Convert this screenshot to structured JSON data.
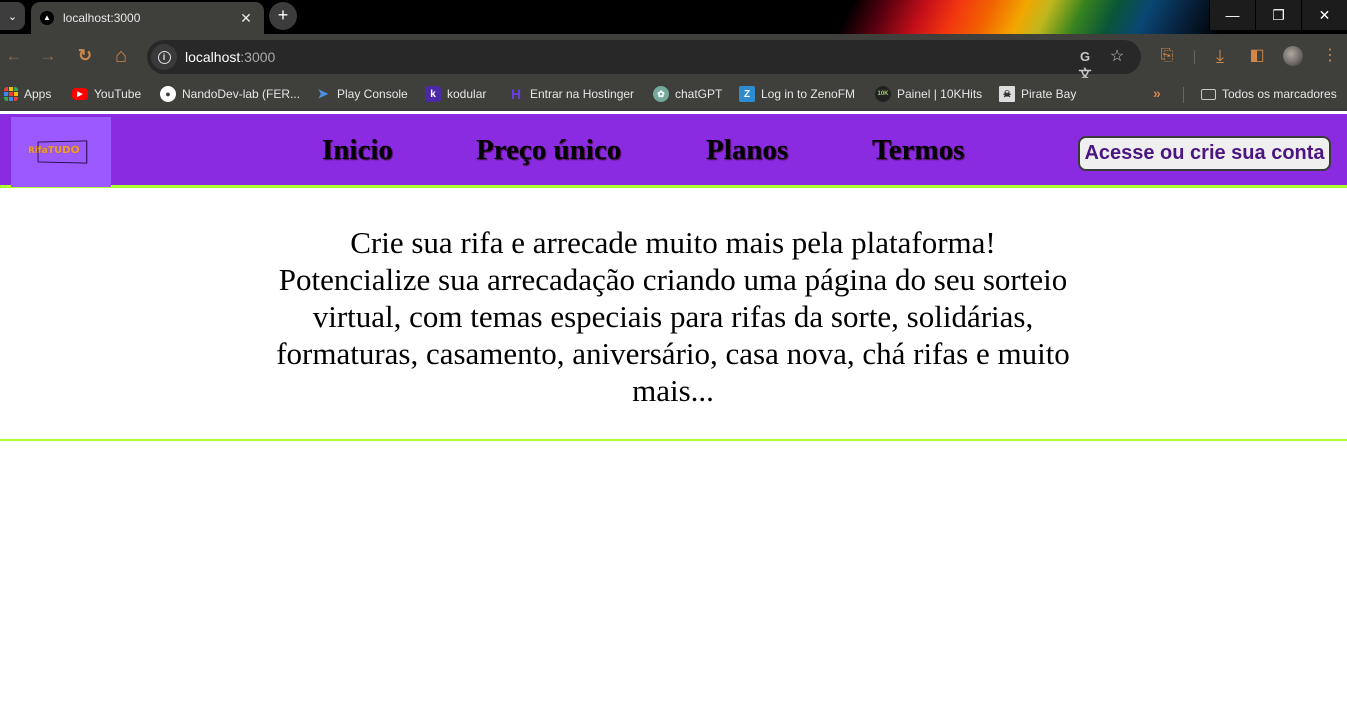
{
  "browser": {
    "tab": {
      "title": "localhost:3000",
      "favicon": "triangle-logo-icon",
      "close_icon": "close-icon"
    },
    "new_tab_icon": "plus-icon",
    "tab_search_icon": "chevron-down-icon",
    "window_controls": {
      "minimize": "—",
      "restore": "❐",
      "close": "✕"
    },
    "toolbar": {
      "back_icon": "←",
      "forward_icon": "→",
      "reload_icon": "↻",
      "home_icon": "⌂",
      "url_host": "localhost",
      "url_port": ":3000",
      "translate_icon": "translate-icon",
      "bookmark_star_icon": "☆",
      "extensions_icon": "puzzle-icon",
      "download_icon": "⤓",
      "sidepanel_icon": "sidepanel-icon",
      "menu_icon": "⋮"
    },
    "bookmarks": [
      {
        "label": "Apps",
        "icon": "apps-grid-icon"
      },
      {
        "label": "YouTube",
        "icon": "youtube-icon"
      },
      {
        "label": "NandoDev-lab (FER...",
        "icon": "github-icon"
      },
      {
        "label": "Play Console",
        "icon": "play-console-icon"
      },
      {
        "label": "kodular",
        "icon": "kodular-icon"
      },
      {
        "label": "Entrar na Hostinger",
        "icon": "hostinger-icon"
      },
      {
        "label": "chatGPT",
        "icon": "chatgpt-icon"
      },
      {
        "label": "Log in to ZenoFM",
        "icon": "zenofm-icon"
      },
      {
        "label": "Painel | 10KHits",
        "icon": "10khits-icon"
      },
      {
        "label": "Pirate Bay",
        "icon": "pirate-bay-icon"
      }
    ],
    "bookmarks_overflow": "»",
    "all_bookmarks_label": "Todos os marcadores"
  },
  "site": {
    "logo_text": "RifaTUDO",
    "nav": [
      {
        "label": "Inicio"
      },
      {
        "label": "Preço único"
      },
      {
        "label": "Planos"
      },
      {
        "label": "Termos"
      }
    ],
    "account_button": "Acesse ou crie sua conta",
    "colors": {
      "header_bg": "#8a2be2",
      "logo_bg": "#9b59ff",
      "accent_line": "#adff2f",
      "account_text": "#4b1582"
    },
    "hero_text": "Crie sua rifa e arrecade muito mais pela plataforma! Potencialize sua arrecadação criando uma página do seu sorteio virtual, com temas especiais para rifas da sorte, solidárias, formaturas, casamento, aniversário, casa nova, chá rifas e muito mais..."
  }
}
